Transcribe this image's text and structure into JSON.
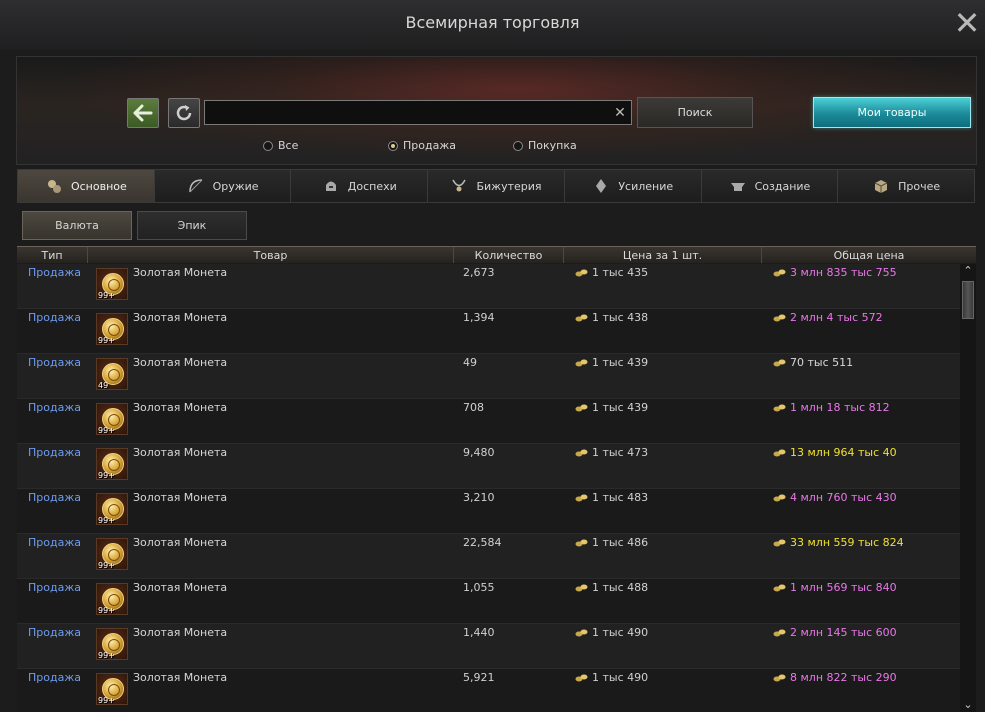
{
  "window": {
    "title": "Всемирная торговля",
    "close_label": "✕"
  },
  "search": {
    "value": "",
    "button_label": "Поиск",
    "my_goods_label": "Мои товары",
    "clear_label": "✕"
  },
  "filters": [
    {
      "label": "Все",
      "selected": false
    },
    {
      "label": "Продажа",
      "selected": true
    },
    {
      "label": "Покупка",
      "selected": false
    }
  ],
  "categories": [
    {
      "label": "Основное",
      "icon": "coins-icon",
      "active": true
    },
    {
      "label": "Оружие",
      "icon": "bow-icon",
      "active": false
    },
    {
      "label": "Доспехи",
      "icon": "helmet-icon",
      "active": false
    },
    {
      "label": "Бижутерия",
      "icon": "necklace-icon",
      "active": false
    },
    {
      "label": "Усиление",
      "icon": "crystal-icon",
      "active": false
    },
    {
      "label": "Создание",
      "icon": "anvil-icon",
      "active": false
    },
    {
      "label": "Прочее",
      "icon": "box-icon",
      "active": false
    }
  ],
  "subcategories": [
    {
      "label": "Валюта",
      "active": true
    },
    {
      "label": "Эпик",
      "active": false
    }
  ],
  "table": {
    "columns": [
      "Тип",
      "Товар",
      "Количество",
      "Цена за 1 шт.",
      "Общая цена"
    ],
    "colors": {
      "magenta": "#e878e8",
      "yellow": "#f0e030",
      "white": "#d8d8d8",
      "type": "#6f9cf0"
    },
    "rows": [
      {
        "type": "Продажа",
        "item": "Золотая Монета",
        "stack": "99+",
        "qty": "2,673",
        "unit": "1 тыс 435",
        "total": "3 млн 835 тыс 755",
        "total_color": "magenta"
      },
      {
        "type": "Продажа",
        "item": "Золотая Монета",
        "stack": "99+",
        "qty": "1,394",
        "unit": "1 тыс 438",
        "total": "2 млн 4 тыс 572",
        "total_color": "magenta"
      },
      {
        "type": "Продажа",
        "item": "Золотая Монета",
        "stack": "49",
        "qty": "49",
        "unit": "1 тыс 439",
        "total": "70 тыс 511",
        "total_color": "white"
      },
      {
        "type": "Продажа",
        "item": "Золотая Монета",
        "stack": "99+",
        "qty": "708",
        "unit": "1 тыс 439",
        "total": "1 млн 18 тыс 812",
        "total_color": "magenta"
      },
      {
        "type": "Продажа",
        "item": "Золотая Монета",
        "stack": "99+",
        "qty": "9,480",
        "unit": "1 тыс 473",
        "total": "13 млн 964 тыс 40",
        "total_color": "yellow"
      },
      {
        "type": "Продажа",
        "item": "Золотая Монета",
        "stack": "99+",
        "qty": "3,210",
        "unit": "1 тыс 483",
        "total": "4 млн 760 тыс 430",
        "total_color": "magenta"
      },
      {
        "type": "Продажа",
        "item": "Золотая Монета",
        "stack": "99+",
        "qty": "22,584",
        "unit": "1 тыс 486",
        "total": "33 млн 559 тыс 824",
        "total_color": "yellow"
      },
      {
        "type": "Продажа",
        "item": "Золотая Монета",
        "stack": "99+",
        "qty": "1,055",
        "unit": "1 тыс 488",
        "total": "1 млн 569 тыс 840",
        "total_color": "magenta"
      },
      {
        "type": "Продажа",
        "item": "Золотая Монета",
        "stack": "99+",
        "qty": "1,440",
        "unit": "1 тыс 490",
        "total": "2 млн 145 тыс 600",
        "total_color": "magenta"
      },
      {
        "type": "Продажа",
        "item": "Золотая Монета",
        "stack": "99+",
        "qty": "5,921",
        "unit": "1 тыс 490",
        "total": "8 млн 822 тыс 290",
        "total_color": "magenta"
      }
    ]
  }
}
